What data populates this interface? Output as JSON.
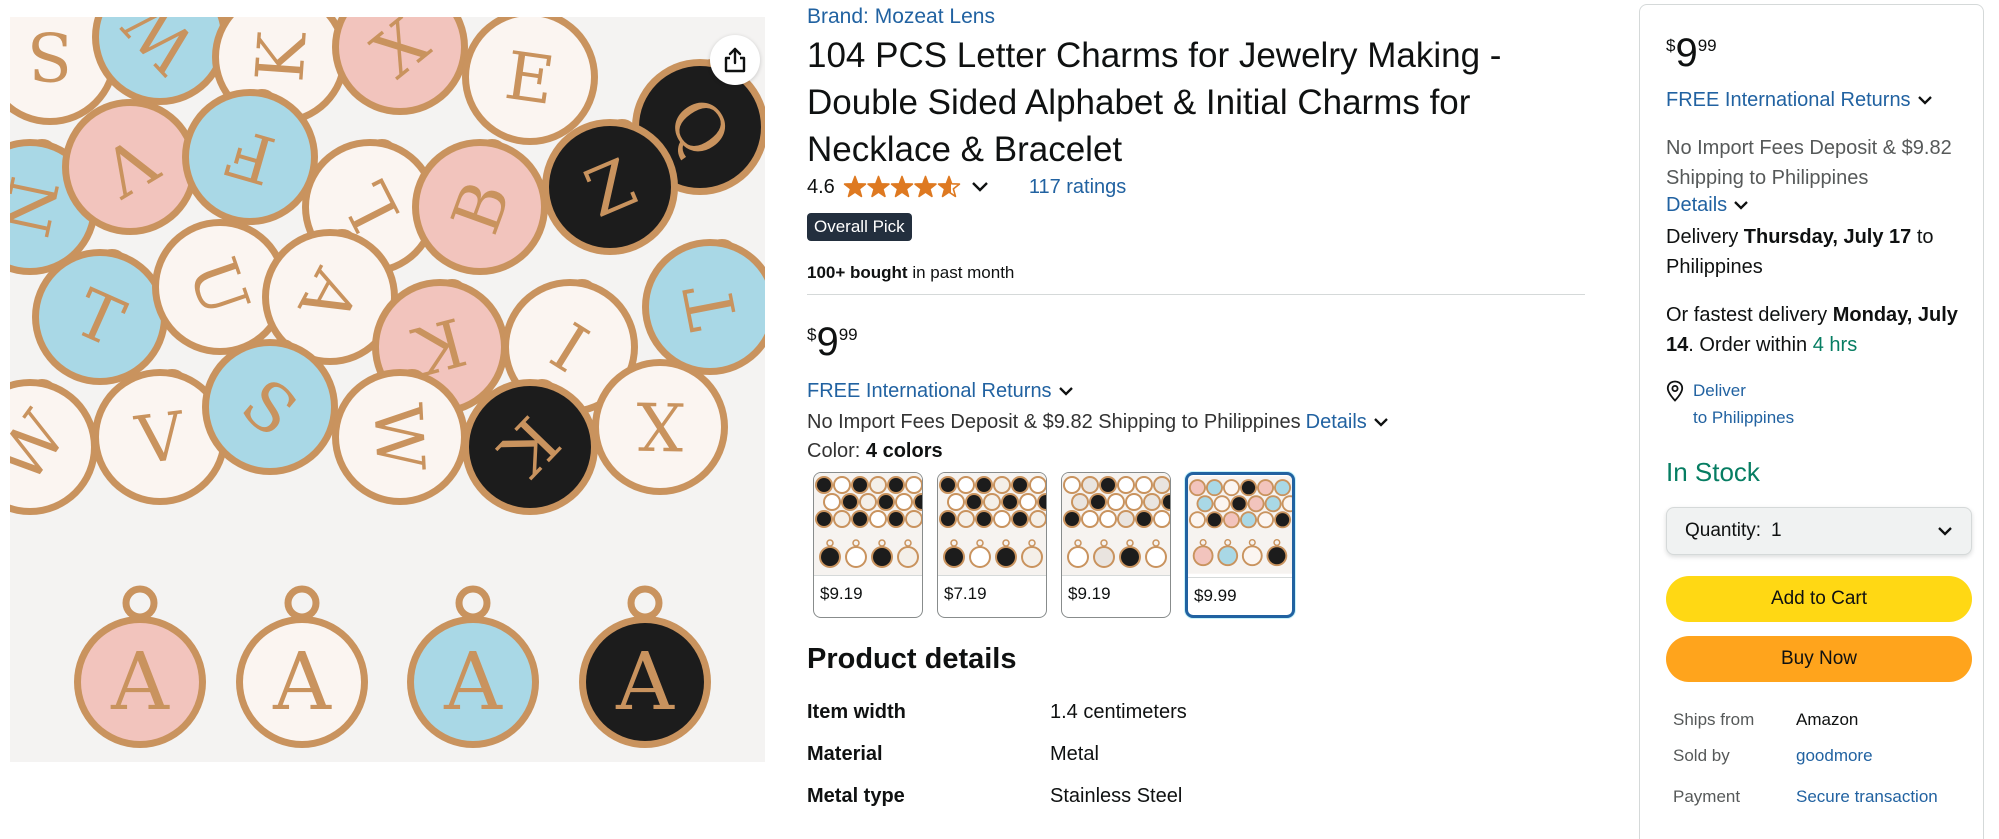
{
  "share": {
    "icon": "share-icon"
  },
  "product_image": {
    "alt_icon": "product-photo",
    "colors": {
      "pink": "#f2c4bd",
      "white": "#fbf5f1",
      "blue": "#a9d8e6",
      "black": "#1c1c1c",
      "gold": "#c9935e"
    },
    "scatter_letters": [
      "S",
      "W",
      "K",
      "X",
      "E",
      "Q",
      "N",
      "V",
      "F",
      "L",
      "B",
      "Z",
      "T",
      "U",
      "A",
      "K",
      "I",
      "T",
      "W",
      "V"
    ],
    "bottom_letters": [
      "A",
      "A",
      "A",
      "A"
    ]
  },
  "center": {
    "brand": "Brand: Mozeat Lens",
    "title": "104 PCS Letter Charms for Jewelry Making - Double Sided Alphabet & Initial Charms for Necklace & Bracelet",
    "rating_value": "4.6",
    "rating_stars": 4.6,
    "ratings_link": "117 ratings",
    "badge": "Overall Pick",
    "bought_bold": "100+ bought",
    "bought_rest": " in past month",
    "price": {
      "symbol": "$",
      "whole": "9",
      "fraction": "99"
    },
    "returns_link": "FREE International Returns",
    "import_text": "No Import Fees Deposit & $9.82 Shipping to Philippines",
    "import_details_link": "Details",
    "color_label": "Color: ",
    "color_value": "4 colors",
    "swatches": [
      {
        "price": "$9.19",
        "selected": false,
        "theme": "black"
      },
      {
        "price": "$7.19",
        "selected": false,
        "theme": "black"
      },
      {
        "price": "$9.19",
        "selected": false,
        "theme": "white"
      },
      {
        "price": "$9.99",
        "selected": true,
        "theme": "pastel"
      }
    ],
    "details_heading": "Product details",
    "details": [
      {
        "key": "Item width",
        "value": "1.4 centimeters"
      },
      {
        "key": "Material",
        "value": "Metal"
      },
      {
        "key": "Metal type",
        "value": "Stainless Steel"
      }
    ]
  },
  "buy_box": {
    "price": {
      "symbol": "$",
      "whole": "9",
      "fraction": "99"
    },
    "returns_link": "FREE International Returns",
    "import_text": "No Import Fees Deposit & $9.82 Shipping to Philippines",
    "details_link": "Details",
    "delivery_prefix": "Delivery ",
    "delivery_date": "Thursday, July 17",
    "delivery_suffix": " to Philippines",
    "fastest_prefix": "Or fastest delivery ",
    "fastest_date": "Monday, July 14",
    "fastest_middle": ". Order within ",
    "fastest_time": "4 hrs",
    "deliver_to_line1": "Deliver",
    "deliver_to_line2": "to Philippines",
    "stock": "In Stock",
    "quantity_label": "Quantity:",
    "quantity_value": "1",
    "add_to_cart": "Add to Cart",
    "buy_now": "Buy Now",
    "info": [
      {
        "key": "Ships from",
        "value": "Amazon",
        "link": false
      },
      {
        "key": "Sold by",
        "value": "goodmore",
        "link": true
      },
      {
        "key": "Payment",
        "value": "Secure transaction",
        "link": true
      }
    ]
  }
}
